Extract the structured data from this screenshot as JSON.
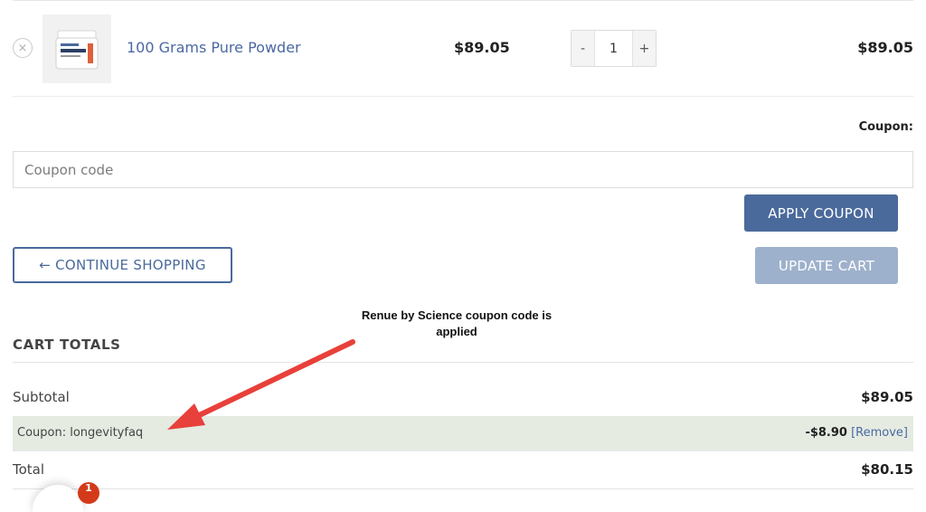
{
  "cart_item": {
    "remove_icon": "×",
    "image_icon": "product-jar-icon",
    "name": "100 Grams Pure Powder",
    "price": "$89.05",
    "qty_minus": "-",
    "quantity": "1",
    "qty_plus": "+",
    "line_total": "$89.05"
  },
  "coupon": {
    "label": "Coupon:",
    "placeholder": "Coupon code",
    "value": "",
    "apply_label": "APPLY COUPON"
  },
  "actions": {
    "continue_label": "← CONTINUE SHOPPING",
    "update_label": "UPDATE CART"
  },
  "annotation": {
    "text": "Renue by Science coupon code is applied"
  },
  "totals": {
    "heading": "CART TOTALS",
    "subtotal_label": "Subtotal",
    "subtotal_value": "$89.05",
    "coupon_row_label": "Coupon: longevityfaq",
    "coupon_discount": "-$8.90",
    "coupon_remove": "[Remove]",
    "total_label": "Total",
    "total_value": "$80.15"
  },
  "chat": {
    "badge_count": "1",
    "icon": "chat-bubble-icon"
  },
  "colors": {
    "primary": "#4a6a9c",
    "primary_disabled": "#9eb1cc",
    "link": "#4a68a4",
    "coupon_row_bg": "#e5ebe1",
    "annotation_arrow": "#e8403a",
    "badge": "#d33a1a"
  }
}
